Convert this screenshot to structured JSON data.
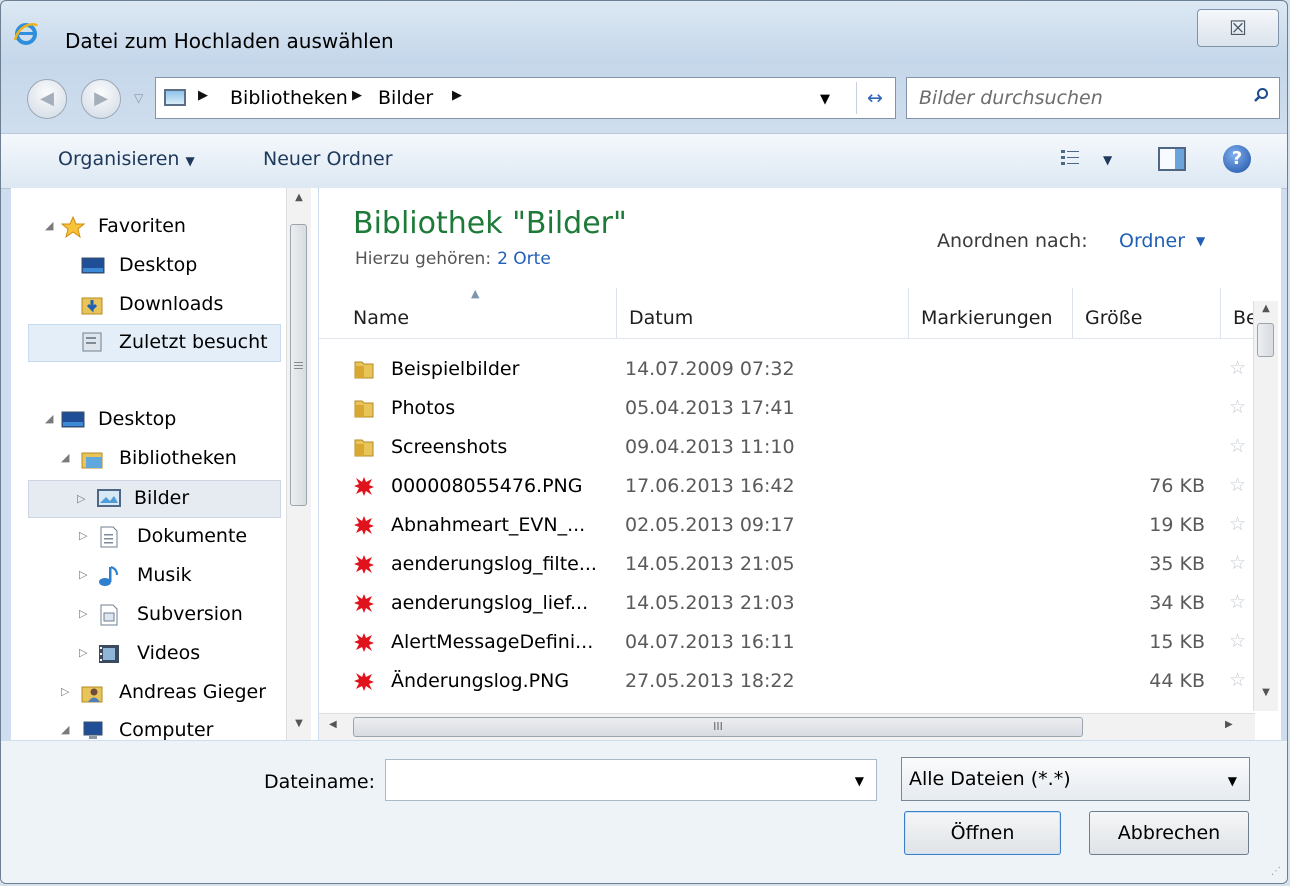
{
  "window": {
    "title": "Datei zum Hochladen auswählen",
    "close_label": "☒"
  },
  "address": {
    "crumbs": [
      "Bibliotheken",
      "Bilder"
    ],
    "search_placeholder": "Bilder durchsuchen"
  },
  "toolbar": {
    "organize": "Organisieren",
    "new_folder": "Neuer Ordner"
  },
  "nav": {
    "items": [
      {
        "label": "Favoriten",
        "icon": "star-icon"
      },
      {
        "label": "Desktop",
        "icon": "desktop-icon"
      },
      {
        "label": "Downloads",
        "icon": "downloads-folder-icon"
      },
      {
        "label": "Zuletzt besucht",
        "icon": "recent-places-icon"
      },
      {
        "label": "Desktop",
        "icon": "desktop-icon"
      },
      {
        "label": "Bibliotheken",
        "icon": "libraries-icon"
      },
      {
        "label": "Bilder",
        "icon": "pictures-library-icon"
      },
      {
        "label": "Dokumente",
        "icon": "documents-library-icon"
      },
      {
        "label": "Musik",
        "icon": "music-library-icon"
      },
      {
        "label": "Subversion",
        "icon": "subversion-library-icon"
      },
      {
        "label": "Videos",
        "icon": "videos-library-icon"
      },
      {
        "label": "Andreas Gieger",
        "icon": "user-folder-icon"
      },
      {
        "label": "Computer",
        "icon": "computer-icon"
      }
    ]
  },
  "library": {
    "title": "Bibliothek \"Bilder\"",
    "subtitle": "Hierzu gehören:",
    "locations_link": "2 Orte",
    "arrange_label": "Anordnen nach:",
    "arrange_value": "Ordner"
  },
  "columns": {
    "name": "Name",
    "date": "Datum",
    "tags": "Markierungen",
    "size": "Größe",
    "rating": "Be"
  },
  "files": [
    {
      "name": "Beispielbilder",
      "date": "14.07.2009 07:32",
      "size": "",
      "type": "folder"
    },
    {
      "name": "Photos",
      "date": "05.04.2013 17:41",
      "size": "",
      "type": "folder"
    },
    {
      "name": "Screenshots",
      "date": "09.04.2013 11:10",
      "size": "",
      "type": "folder"
    },
    {
      "name": "000008055476.PNG",
      "date": "17.06.2013 16:42",
      "size": "76 KB",
      "type": "png"
    },
    {
      "name": "Abnahmeart_EVN_...",
      "date": "02.05.2013 09:17",
      "size": "19 KB",
      "type": "png"
    },
    {
      "name": "aenderungslog_filte...",
      "date": "14.05.2013 21:05",
      "size": "35 KB",
      "type": "png"
    },
    {
      "name": "aenderungslog_lief...",
      "date": "14.05.2013 21:03",
      "size": "34 KB",
      "type": "png"
    },
    {
      "name": "AlertMessageDefini...",
      "date": "04.07.2013 16:11",
      "size": "15 KB",
      "type": "png"
    },
    {
      "name": "Änderungslog.PNG",
      "date": "27.05.2013 18:22",
      "size": "44 KB",
      "type": "png"
    }
  ],
  "bottom": {
    "filename_label": "Dateiname:",
    "filename_value": "",
    "filetype_value": "Alle Dateien (*.*)",
    "open_button": "Öffnen",
    "cancel_button": "Abbrechen"
  },
  "colors": {
    "library_title": "#1e7a38",
    "link": "#1f5fb5",
    "png_icon": "#e0121b"
  }
}
